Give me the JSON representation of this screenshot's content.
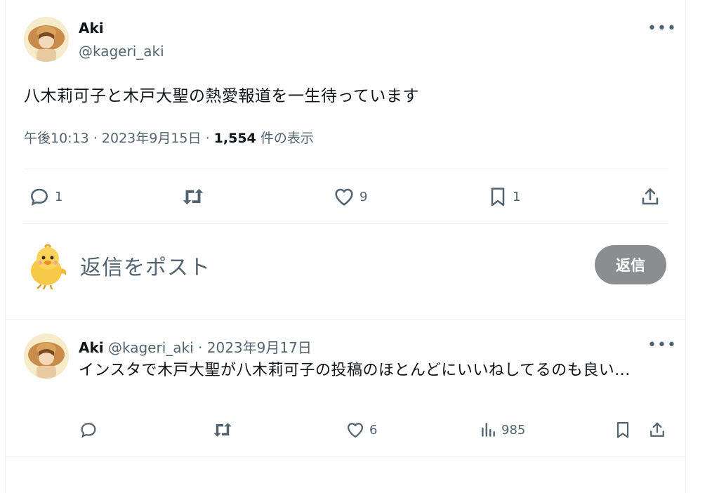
{
  "main_tweet": {
    "author_name": "Aki",
    "author_handle": "@kageri_aki",
    "text": "八木莉可子と木戸大聖の熱愛報道を一生待っています",
    "time": "午後10:13",
    "sep1": "·",
    "date": "2023年9月15日",
    "sep2": "·",
    "views": "1,554",
    "views_label": "件の表示",
    "more_label": "•••",
    "actions": {
      "reply_count": "1",
      "retweet_count": "",
      "like_count": "9",
      "bookmark_count": "1"
    }
  },
  "composer": {
    "placeholder": "返信をポスト",
    "button_label": "返信"
  },
  "reply_tweet": {
    "author_name": "Aki",
    "author_handle": "@kageri_aki",
    "sep": "·",
    "date": "2023年9月17日",
    "more_label": "•••",
    "text": "インスタで木戸大聖が八木莉可子の投稿のほとんどにいいねしてるのも良い...",
    "actions": {
      "reply_count": "",
      "retweet_count": "",
      "like_count": "6",
      "views_count": "985"
    }
  },
  "colors": {
    "text_primary": "#0f1419",
    "text_secondary": "#536471",
    "divider": "#eff3f4",
    "reply_button": "#8b8e91"
  },
  "icons": [
    "reply-icon",
    "retweet-icon",
    "heart-icon",
    "bookmark-icon",
    "share-icon",
    "views-icon",
    "more-icon"
  ]
}
